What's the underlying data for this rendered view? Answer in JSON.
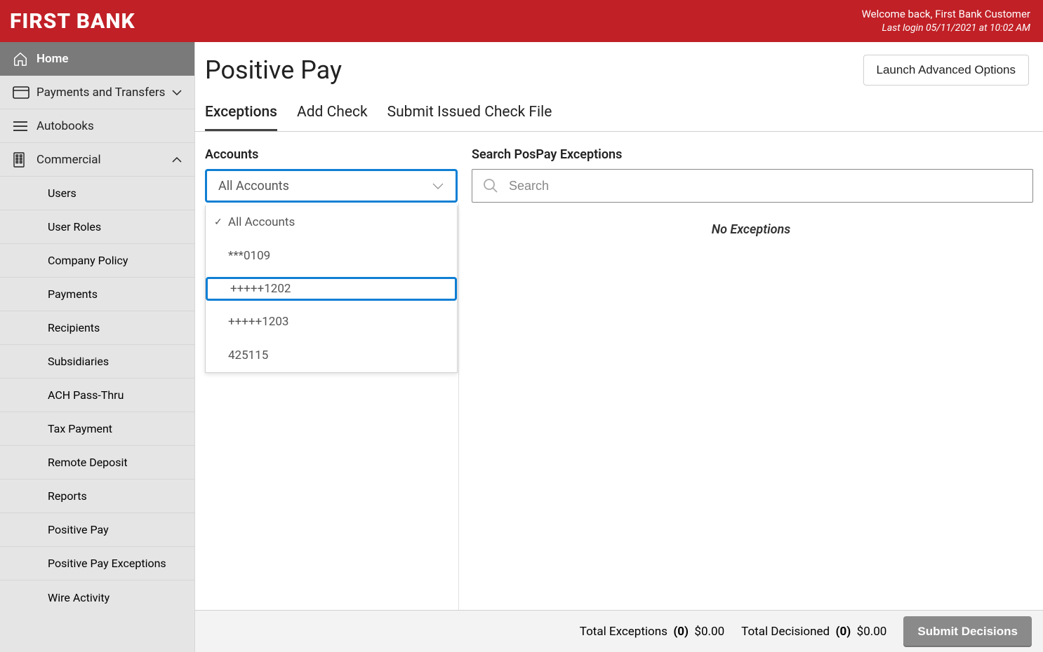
{
  "brand": {
    "name": "FIRST BANK"
  },
  "welcome": {
    "line1": "Welcome back, First Bank Customer",
    "line2": "Last login 05/11/2021 at 10:02 AM"
  },
  "sidebar": {
    "home": "Home",
    "payments": "Payments and Transfers",
    "autobooks": "Autobooks",
    "commercial": "Commercial",
    "commercial_items": [
      "Users",
      "User Roles",
      "Company Policy",
      "Payments",
      "Recipients",
      "Subsidiaries",
      "ACH Pass-Thru",
      "Tax Payment",
      "Remote Deposit",
      "Reports",
      "Positive Pay",
      "Positive Pay Exceptions",
      "Wire Activity"
    ]
  },
  "page": {
    "title": "Positive Pay",
    "advanced_btn": "Launch Advanced Options"
  },
  "tabs": [
    {
      "label": "Exceptions",
      "active": true
    },
    {
      "label": "Add Check",
      "active": false
    },
    {
      "label": "Submit Issued Check File",
      "active": false
    }
  ],
  "accounts": {
    "label": "Accounts",
    "selected": "All Accounts",
    "options": [
      {
        "label": "All Accounts",
        "checked": true,
        "focused": false
      },
      {
        "label": "***0109",
        "checked": false,
        "focused": false
      },
      {
        "label": "+++++1202",
        "checked": false,
        "focused": true
      },
      {
        "label": "+++++1203",
        "checked": false,
        "focused": false
      },
      {
        "label": "425115",
        "checked": false,
        "focused": false
      }
    ]
  },
  "search": {
    "label": "Search PosPay Exceptions",
    "placeholder": "Search"
  },
  "results": {
    "empty_text": "No Exceptions"
  },
  "footer": {
    "total_exceptions_label": "Total Exceptions",
    "total_exceptions_count": "(0)",
    "total_exceptions_amount": "$0.00",
    "total_decisioned_label": "Total Decisioned",
    "total_decisioned_count": "(0)",
    "total_decisioned_amount": "$0.00",
    "submit_label": "Submit Decisions"
  }
}
